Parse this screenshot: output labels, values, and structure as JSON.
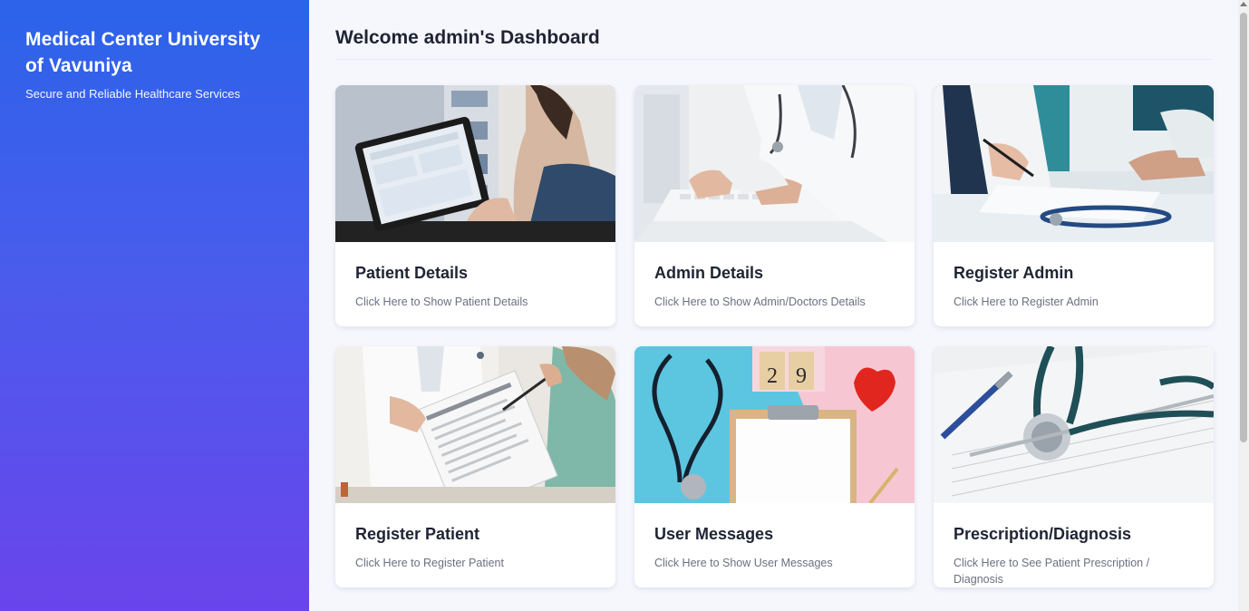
{
  "sidebar": {
    "title": "Medical Center University of Vavuniya",
    "tagline": "Secure and Reliable Healthcare Services"
  },
  "main": {
    "title": "Welcome admin's Dashboard",
    "cards": [
      {
        "title": "Patient Details",
        "description": "Click Here to Show Patient Details",
        "image": "tablet-clinic-photo"
      },
      {
        "title": "Admin Details",
        "description": "Click Here to Show Admin/Doctors Details",
        "image": "doctor-typing-photo"
      },
      {
        "title": "Register Admin",
        "description": "Click Here to Register Admin",
        "image": "doctor-writing-photo"
      },
      {
        "title": "Register Patient",
        "description": "Click Here to Register Patient",
        "image": "registration-form-photo"
      },
      {
        "title": "User Messages",
        "description": "Click Here to Show User Messages",
        "image": "stethoscope-clipboard-photo"
      },
      {
        "title": "Prescription/Diagnosis",
        "description": "Click Here to See Patient Prescription / Diagnosis",
        "image": "stethoscope-pen-photo"
      }
    ]
  },
  "colors": {
    "sidebar_top": "#2b63ea",
    "sidebar_bottom": "#6a44ec",
    "title_text": "#1f2433",
    "muted_text": "#6b7080"
  }
}
